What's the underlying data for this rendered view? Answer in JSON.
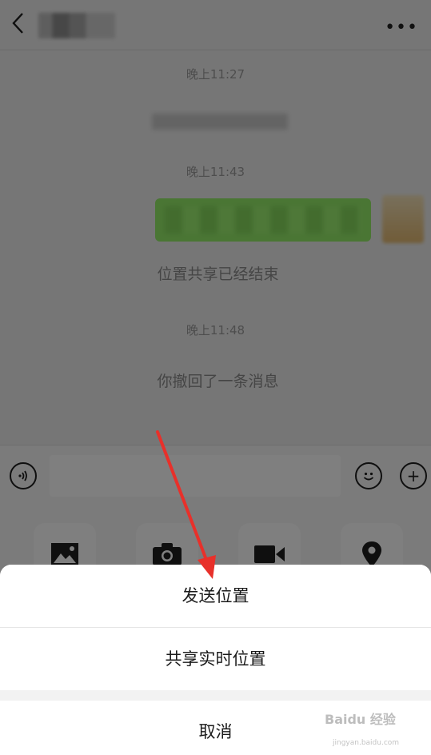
{
  "header": {
    "title": "",
    "more_label": "•••"
  },
  "messages": {
    "timestamp_1": "晚上11:27",
    "timestamp_2": "晚上11:43",
    "location_share_ended": "位置共享已经结束",
    "timestamp_3": "晚上11:48",
    "recalled_notice": "你撤回了一条消息"
  },
  "input_bar": {
    "add_label": "+"
  },
  "tools": [
    {
      "icon": "image-icon"
    },
    {
      "icon": "camera-icon"
    },
    {
      "icon": "video-call-icon"
    },
    {
      "icon": "location-icon"
    }
  ],
  "action_sheet": {
    "send_location": "发送位置",
    "share_live_location": "共享实时位置",
    "cancel": "取消"
  },
  "watermark": {
    "brand": "Baidu 经验",
    "url": "jingyan.baidu.com"
  },
  "colors": {
    "bubble_green": "#95ec69",
    "arrow_red": "#e8302a"
  }
}
